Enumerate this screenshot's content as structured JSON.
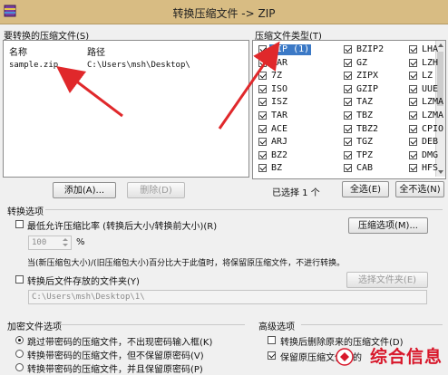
{
  "window": {
    "title": "转换压缩文件 -> ZIP"
  },
  "files_panel": {
    "label": "要转换的压缩文件(S)",
    "columns": [
      "名称",
      "路径"
    ],
    "rows": [
      {
        "name": "sample.zip",
        "path": "C:\\Users\\msh\\Desktop\\"
      }
    ],
    "add_button": "添加(A)...",
    "delete_button": "删除(D)"
  },
  "types_panel": {
    "label": "压缩文件类型(T)",
    "formats": [
      [
        "ZIP (1)",
        "BZIP2",
        "LHA"
      ],
      [
        "RAR",
        "GZ",
        "LZH"
      ],
      [
        "7Z",
        "ZIPX",
        "LZ"
      ],
      [
        "ISO",
        "GZIP",
        "UUE"
      ],
      [
        "ISZ",
        "TAZ",
        "LZMA"
      ],
      [
        "TAR",
        "TBZ",
        "LZMA"
      ],
      [
        "ACE",
        "TBZ2",
        "CPIO"
      ],
      [
        "ARJ",
        "TGZ",
        "DEB"
      ],
      [
        "BZ2",
        "TPZ",
        "DMG"
      ],
      [
        "BZ",
        "CAB",
        "HFS"
      ]
    ],
    "selected_count": "已选择 1 个",
    "select_all": "全选(E)",
    "select_none": "全不选(N)"
  },
  "convert_options": {
    "label": "转换选项",
    "min_ratio_checkbox": "最低允许压缩比率 (转换后大小/转换前大小)(R)",
    "ratio_value": "100",
    "ratio_unit": "%",
    "compress_options_button": "压缩选项(M)...",
    "ratio_note": "当(新压缩包大小)/(旧压缩包大小)百分比大于此值时，将保留原压缩文件，不进行转换。",
    "save_folder_checkbox": "转换后文件存放的文件夹(Y)",
    "folder_path": "C:\\Users\\msh\\Desktop\\1\\",
    "select_folder_button": "选择文件夹(E)"
  },
  "encrypted_options": {
    "label": "加密文件选项",
    "options": [
      "跳过带密码的压缩文件，不出现密码输入框(K)",
      "转换带密码的压缩文件，但不保留原密码(V)",
      "转换带密码的压缩文件，并且保留原密码(P)"
    ]
  },
  "advanced_options": {
    "label": "高级选项",
    "options": [
      "转换后删除原来的压缩文件(D)",
      "保留原压缩文件中的"
    ]
  },
  "watermark": {
    "text": "综合信息"
  },
  "colors": {
    "titlebar": "#d8bc83",
    "selection": "#3b79c6",
    "arrow": "#e0282b",
    "watermark": "#d8182b"
  }
}
